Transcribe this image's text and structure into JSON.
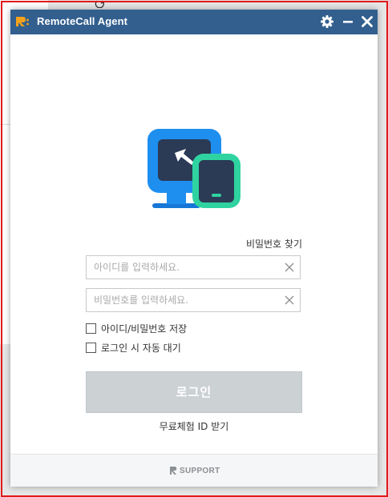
{
  "app": {
    "title": "RemoteCall Agent"
  },
  "form": {
    "find_password_label": "비밀번호 찾기",
    "id_placeholder": "아이디를 입력하세요.",
    "password_placeholder": "비밀번호를 입력하세요.",
    "save_credentials_label": "아이디/비밀번호 저장",
    "auto_login_label": "로그인 시 자동 대기",
    "login_button_label": "로그인",
    "free_trial_label": "무료체험 ID 받기"
  },
  "footer": {
    "brand": "SUPPORT"
  },
  "icons": {
    "settings": "gear-icon",
    "minimize": "minimize-icon",
    "close": "close-icon",
    "clear": "clear-icon"
  },
  "colors": {
    "titlebar": "#325f8e",
    "monitor_blue": "#1e8fef",
    "device_green": "#2fd3a0",
    "screen_dark": "#2b3a55",
    "login_disabled": "#ccd1d4",
    "brand_orange": "#f5a21b"
  }
}
